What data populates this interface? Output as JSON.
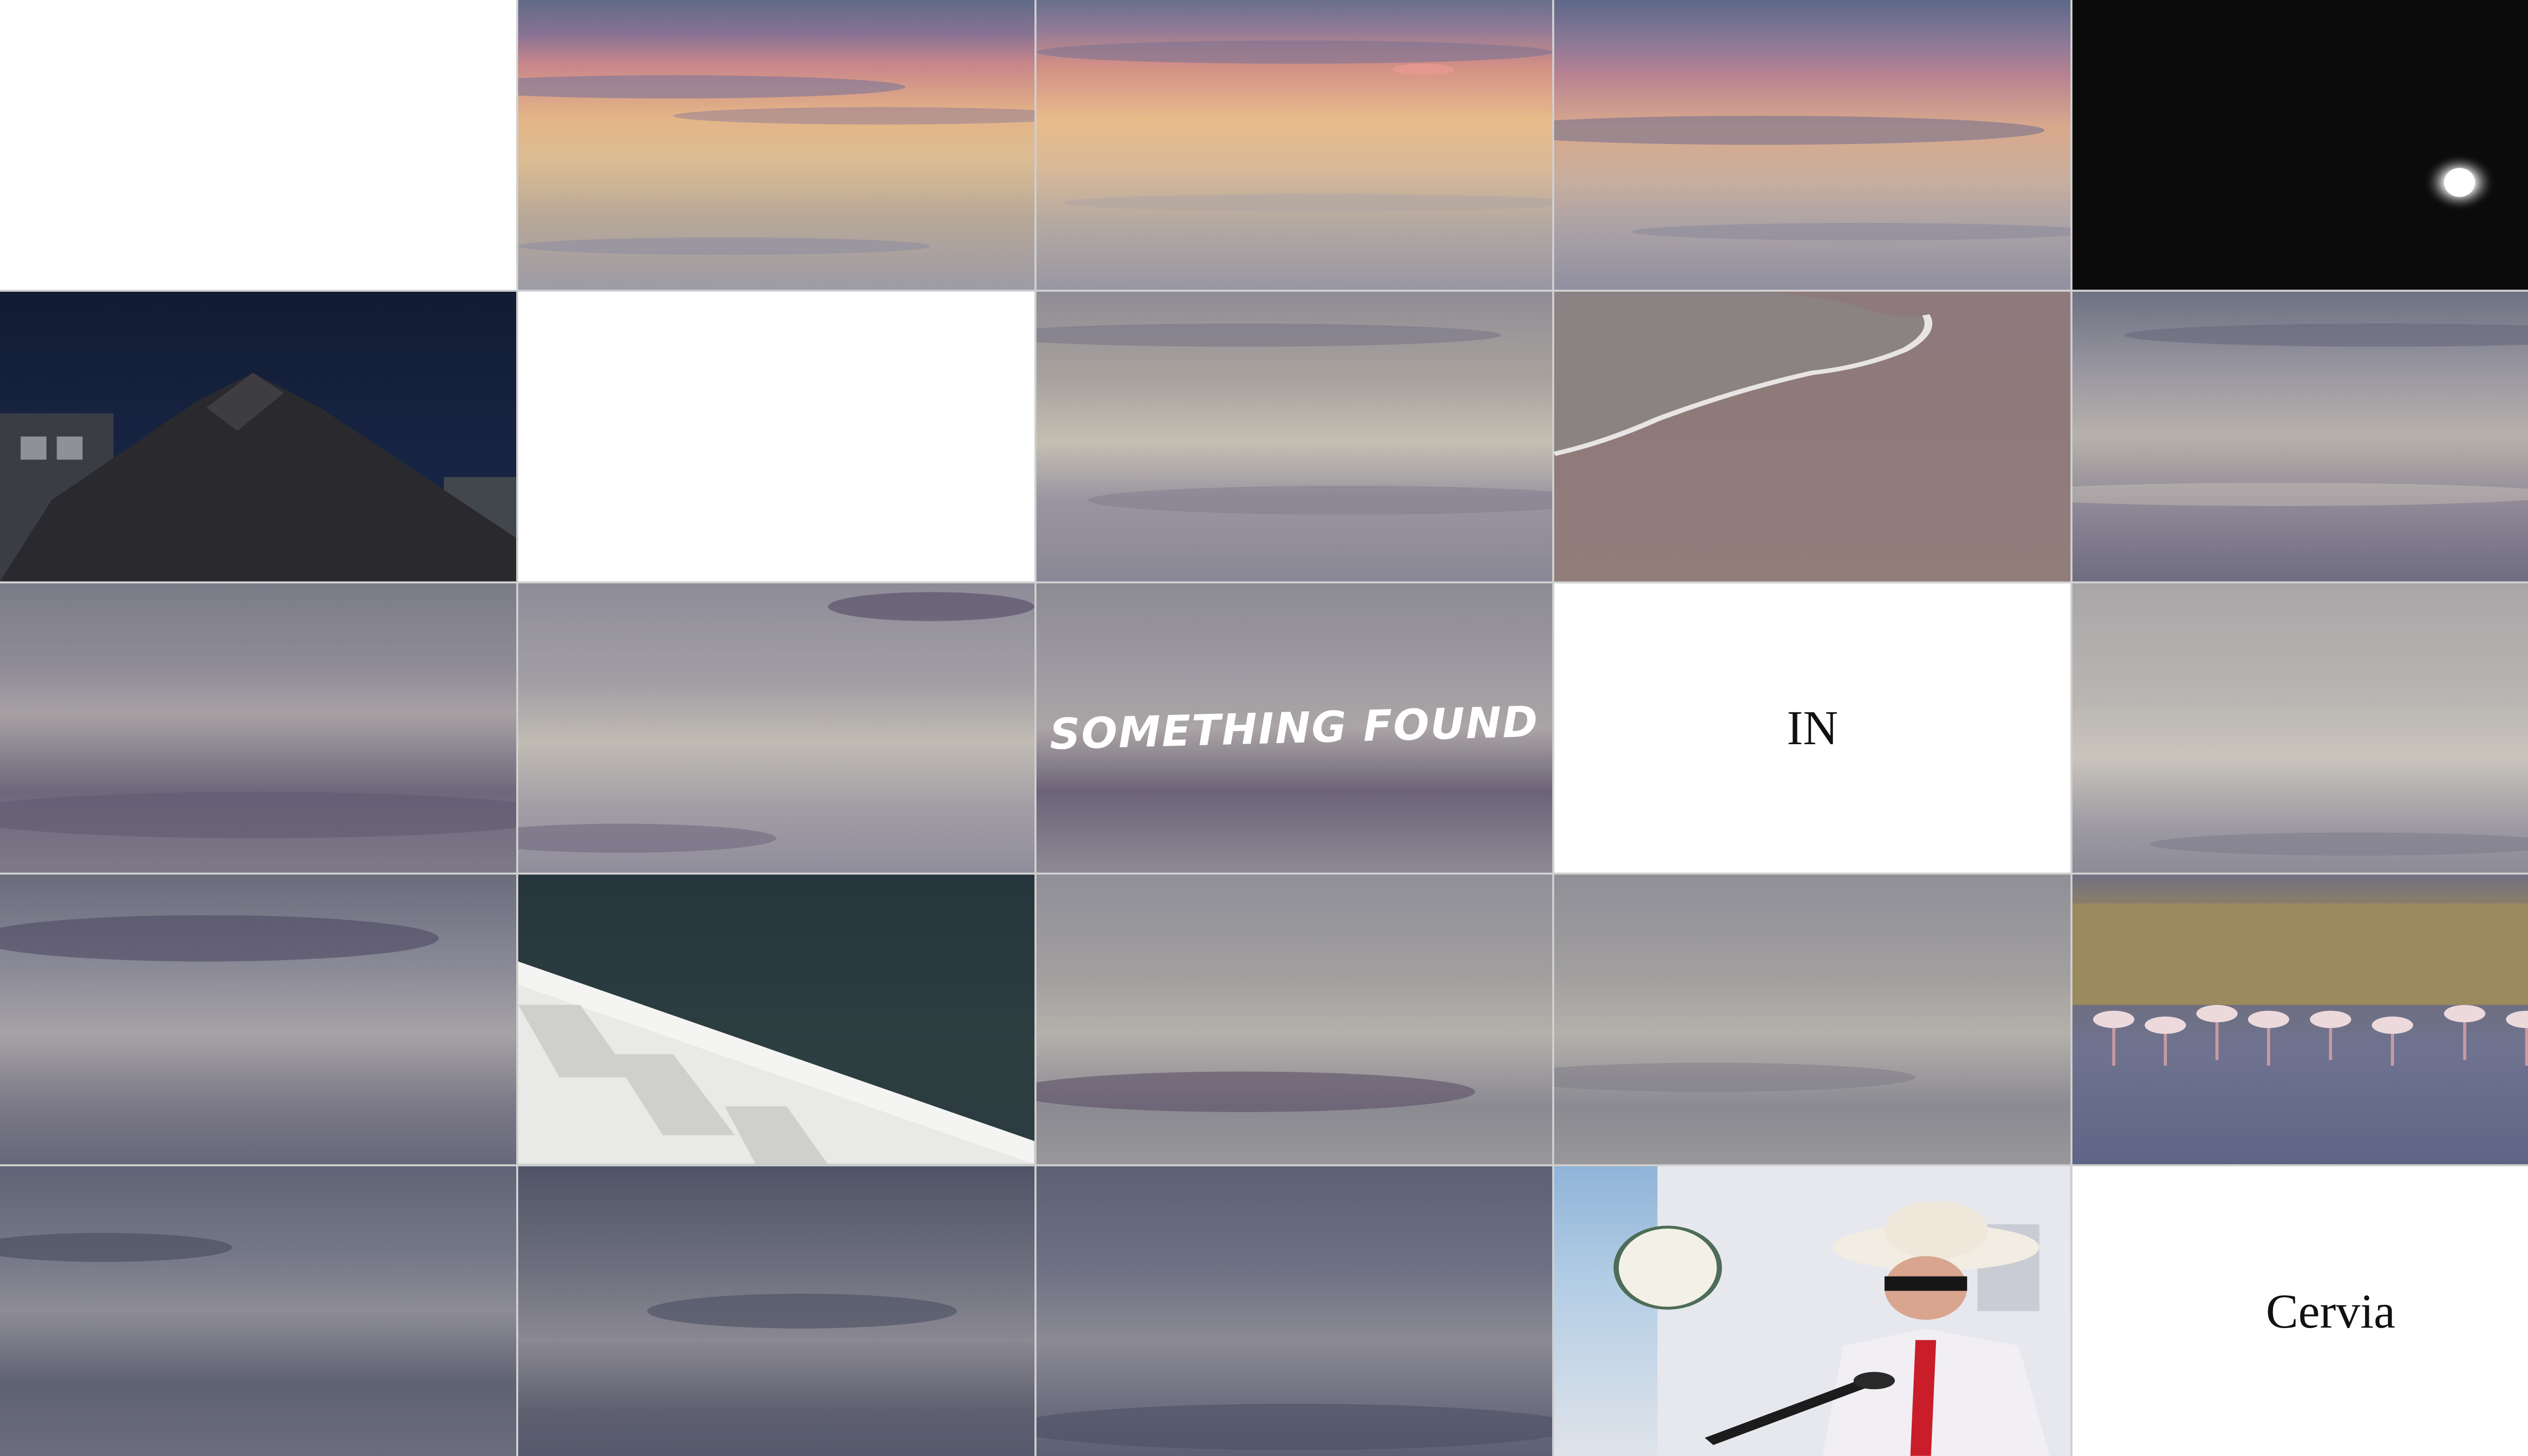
{
  "grid": {
    "rows": 5,
    "columns": 5,
    "tiles": [
      {
        "name": "tile-blank",
        "kind": "white"
      },
      {
        "name": "tile-sunset-sky",
        "kind": "sunset"
      },
      {
        "name": "tile-sunset-sky",
        "kind": "sunset2"
      },
      {
        "name": "tile-sunset-sky",
        "kind": "sunset3"
      },
      {
        "name": "tile-night-moon",
        "kind": "black"
      },
      {
        "name": "tile-night-building",
        "kind": "night"
      },
      {
        "name": "tile-blank",
        "kind": "white"
      },
      {
        "name": "tile-cloud-reflection",
        "kind": "grey1"
      },
      {
        "name": "tile-beach-wave",
        "kind": "sand"
      },
      {
        "name": "tile-cloud-reflection",
        "kind": "grey2"
      },
      {
        "name": "tile-cloud-reflection",
        "kind": "grey3"
      },
      {
        "name": "tile-cloud-reflection",
        "kind": "grey4"
      },
      {
        "name": "tile-title-something-found",
        "kind": "grey8",
        "text": "SOMETHING FOUND"
      },
      {
        "name": "tile-title-in",
        "kind": "white",
        "text": "IN"
      },
      {
        "name": "tile-cloud-reflection",
        "kind": "grey5"
      },
      {
        "name": "tile-cloud-reflection",
        "kind": "grey7"
      },
      {
        "name": "tile-boat-pond",
        "kind": "pond"
      },
      {
        "name": "tile-cloud-reflection",
        "kind": "grey9"
      },
      {
        "name": "tile-cloud-reflection",
        "kind": "grey9"
      },
      {
        "name": "tile-flamingos",
        "kind": "flamingo"
      },
      {
        "name": "tile-cloud-reflection",
        "kind": "grey11"
      },
      {
        "name": "tile-cloud-reflection",
        "kind": "grey12"
      },
      {
        "name": "tile-cloud-reflection",
        "kind": "grey6"
      },
      {
        "name": "tile-masked-man-microphone",
        "kind": "street"
      },
      {
        "name": "tile-title-cervia",
        "kind": "white",
        "text": "Cervia"
      }
    ]
  },
  "titles": {
    "something_found": "SOMETHING FOUND",
    "in": "IN",
    "place": "Cervia"
  }
}
